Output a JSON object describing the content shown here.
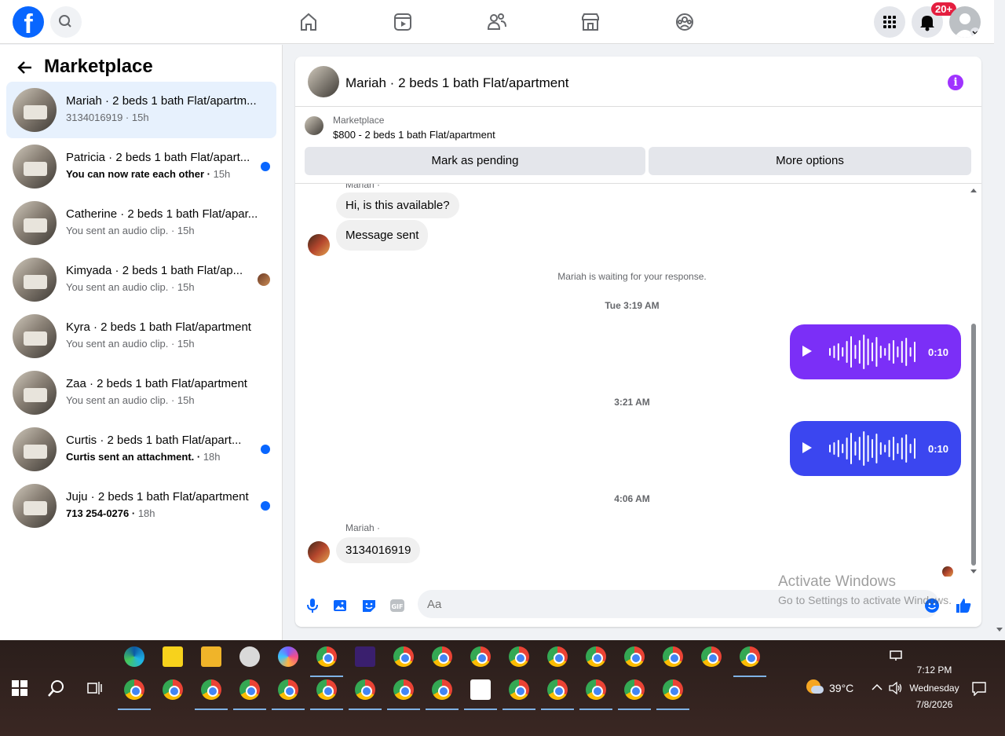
{
  "nav": {
    "logo": "f",
    "notifications_badge": "20+"
  },
  "sidebar": {
    "header": "Marketplace",
    "conversations": [
      {
        "title": "Mariah · 2 beds 1 bath Flat/apartm...",
        "subtitle": "3134016919",
        "time": "15h",
        "unread": false
      },
      {
        "title": "Patricia · 2 beds 1 bath Flat/apart...",
        "subtitle": "You can now rate each other",
        "time": "15h",
        "unread": true
      },
      {
        "title": "Catherine · 2 beds 1 bath Flat/apar...",
        "subtitle": "You sent an audio clip.",
        "time": "15h",
        "unread": false
      },
      {
        "title": "Kimyada · 2 beds 1 bath Flat/ap...",
        "subtitle": "You sent an audio clip.",
        "time": "15h",
        "unread": false
      },
      {
        "title": "Kyra · 2 beds 1 bath Flat/apartment",
        "subtitle": "You sent an audio clip.",
        "time": "15h",
        "unread": false
      },
      {
        "title": "Zaa · 2 beds 1 bath Flat/apartment",
        "subtitle": "You sent an audio clip.",
        "time": "15h",
        "unread": false
      },
      {
        "title": "Curtis · 2 beds 1 bath Flat/apart...",
        "subtitle": "Curtis sent an attachment.",
        "time": "18h",
        "unread": true
      },
      {
        "title": "Juju · 2 beds 1 bath Flat/apartment",
        "subtitle": "713 254-0276",
        "time": "18h",
        "unread": true
      }
    ]
  },
  "chat": {
    "title": "Mariah · 2 beds 1 bath Flat/apartment",
    "info_icon": "i",
    "listing_source": "Marketplace",
    "listing_price": "$800 - 2 beds 1 bath Flat/apartment",
    "mark_pending": "Mark as pending",
    "more_options": "More options",
    "sender_top": "Mariah ·",
    "msg1": "Hi, is this available?",
    "msg2": "Message sent",
    "waiting_note": "Mariah is waiting for your response.",
    "ts1": "Tue 3:19 AM",
    "audio1_duration": "0:10",
    "ts2": "3:21 AM",
    "audio2_duration": "0:10",
    "ts3": "4:06 AM",
    "sender_bottom": "Mariah ·",
    "msg3": "3134016919",
    "composer_placeholder": "Aa",
    "audio1_color": "#7b2ff7",
    "audio2_color": "#3b46f0"
  },
  "watermark": {
    "line1": "Activate Windows",
    "line2": "Go to Settings to activate Windows."
  },
  "taskbar": {
    "temperature": "39°C",
    "time": "7:12 PM",
    "day": "Wednesday",
    "date": "7/8/2026"
  }
}
